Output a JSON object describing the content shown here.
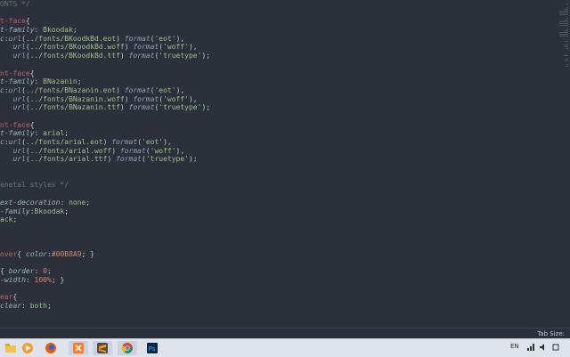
{
  "editor": {
    "lines": [
      [
        [
          "cmt",
          "ONTS */"
        ]
      ],
      [],
      [
        [
          "sel",
          "t-face"
        ],
        [
          "pl",
          "{"
        ]
      ],
      [
        [
          "prop",
          "t-family"
        ],
        [
          "pl",
          ": "
        ],
        [
          "val",
          "Bkoodak"
        ],
        [
          "pl",
          ";"
        ]
      ],
      [
        [
          "prop",
          "c"
        ],
        [
          "pl",
          ":"
        ],
        [
          "fn",
          "url"
        ],
        [
          "pl",
          "("
        ],
        [
          "val",
          "../fonts/BKoodkBd.eot"
        ],
        [
          "pl",
          ") "
        ],
        [
          "fn",
          "format"
        ],
        [
          "pl",
          "("
        ],
        [
          "val",
          "'eot'"
        ],
        [
          "pl",
          "),"
        ]
      ],
      [
        [
          "pl",
          "   "
        ],
        [
          "fn",
          "url"
        ],
        [
          "pl",
          "("
        ],
        [
          "val",
          "../fonts/BKoodkBd.woff"
        ],
        [
          "pl",
          ") "
        ],
        [
          "fn",
          "format"
        ],
        [
          "pl",
          "("
        ],
        [
          "val",
          "'woff'"
        ],
        [
          "pl",
          "),"
        ]
      ],
      [
        [
          "pl",
          "   "
        ],
        [
          "fn",
          "url"
        ],
        [
          "pl",
          "("
        ],
        [
          "val",
          "../fonts/BKoodkBd.ttf"
        ],
        [
          "pl",
          ") "
        ],
        [
          "fn",
          "format"
        ],
        [
          "pl",
          "("
        ],
        [
          "val",
          "'truetype'"
        ],
        [
          "pl",
          ");"
        ]
      ],
      [],
      [
        [
          "sel",
          "nt-face"
        ],
        [
          "pl",
          "{"
        ]
      ],
      [
        [
          "prop",
          "t-family"
        ],
        [
          "pl",
          ": "
        ],
        [
          "val",
          "BNazanin"
        ],
        [
          "pl",
          ";"
        ]
      ],
      [
        [
          "prop",
          "c"
        ],
        [
          "pl",
          ":"
        ],
        [
          "fn",
          "url"
        ],
        [
          "pl",
          "("
        ],
        [
          "val",
          "../fonts/BNazanin.eot"
        ],
        [
          "pl",
          ") "
        ],
        [
          "fn",
          "format"
        ],
        [
          "pl",
          "("
        ],
        [
          "val",
          "'eot'"
        ],
        [
          "pl",
          "),"
        ]
      ],
      [
        [
          "pl",
          "   "
        ],
        [
          "fn",
          "url"
        ],
        [
          "pl",
          "("
        ],
        [
          "val",
          "../fonts/BNazanin.woff"
        ],
        [
          "pl",
          ") "
        ],
        [
          "fn",
          "format"
        ],
        [
          "pl",
          "("
        ],
        [
          "val",
          "'woff'"
        ],
        [
          "pl",
          "),"
        ]
      ],
      [
        [
          "pl",
          "   "
        ],
        [
          "fn",
          "url"
        ],
        [
          "pl",
          "("
        ],
        [
          "val",
          "../fonts/BNazanin.ttf"
        ],
        [
          "pl",
          ") "
        ],
        [
          "fn",
          "format"
        ],
        [
          "pl",
          "("
        ],
        [
          "val",
          "'truetype'"
        ],
        [
          "pl",
          ");"
        ]
      ],
      [],
      [
        [
          "sel",
          "nt-face"
        ],
        [
          "pl",
          "{"
        ]
      ],
      [
        [
          "prop",
          "t-family"
        ],
        [
          "pl",
          ": "
        ],
        [
          "val",
          "arial"
        ],
        [
          "pl",
          ";"
        ]
      ],
      [
        [
          "prop",
          "c"
        ],
        [
          "pl",
          ":"
        ],
        [
          "fn",
          "url"
        ],
        [
          "pl",
          "("
        ],
        [
          "val",
          "../fonts/arial.eot"
        ],
        [
          "pl",
          ") "
        ],
        [
          "fn",
          "format"
        ],
        [
          "pl",
          "("
        ],
        [
          "val",
          "'eot'"
        ],
        [
          "pl",
          "),"
        ]
      ],
      [
        [
          "pl",
          "   "
        ],
        [
          "fn",
          "url"
        ],
        [
          "pl",
          "("
        ],
        [
          "val",
          "../fonts/arial.woff"
        ],
        [
          "pl",
          ") "
        ],
        [
          "fn",
          "format"
        ],
        [
          "pl",
          "("
        ],
        [
          "val",
          "'woff'"
        ],
        [
          "pl",
          "),"
        ]
      ],
      [
        [
          "pl",
          "   "
        ],
        [
          "fn",
          "url"
        ],
        [
          "pl",
          "("
        ],
        [
          "val",
          "../fonts/arial.ttf"
        ],
        [
          "pl",
          ") "
        ],
        [
          "fn",
          "format"
        ],
        [
          "pl",
          "("
        ],
        [
          "val",
          "'truetype'"
        ],
        [
          "pl",
          ");"
        ]
      ],
      [],
      [],
      [
        [
          "cmt",
          "enetal styles */"
        ]
      ],
      [],
      [
        [
          "prop",
          "ext-decoration"
        ],
        [
          "pl",
          ": "
        ],
        [
          "val",
          "none"
        ],
        [
          "pl",
          ";"
        ]
      ],
      [
        [
          "prop",
          "-family"
        ],
        [
          "pl",
          ":"
        ],
        [
          "val",
          "Bkoodak"
        ],
        [
          "pl",
          ";"
        ]
      ],
      [
        [
          "val",
          "ack"
        ],
        [
          "pl",
          ";"
        ]
      ],
      [],
      [],
      [],
      [
        [
          "sel",
          "over"
        ],
        [
          "pl",
          "{ "
        ],
        [
          "prop",
          "color"
        ],
        [
          "pl",
          ":"
        ],
        [
          "num",
          "#00B8A9"
        ],
        [
          "pl",
          "; }"
        ]
      ],
      [],
      [
        [
          "pl",
          "{ "
        ],
        [
          "prop",
          "border"
        ],
        [
          "pl",
          ": "
        ],
        [
          "num",
          "0"
        ],
        [
          "pl",
          ";"
        ]
      ],
      [
        [
          "prop",
          "-width"
        ],
        [
          "pl",
          ": "
        ],
        [
          "num",
          "100%"
        ],
        [
          "pl",
          "; }"
        ]
      ],
      [],
      [
        [
          "sel",
          "ear"
        ],
        [
          "pl",
          "{"
        ]
      ],
      [
        [
          "prop",
          "clear"
        ],
        [
          "pl",
          ": "
        ],
        [
          "val",
          "both"
        ],
        [
          "pl",
          ";"
        ]
      ]
    ]
  },
  "statusbar": {
    "tab_size": "Tab Size:"
  },
  "taskbar": {
    "apps": [
      {
        "name": "file-explorer-icon",
        "color": "#f2c14e"
      },
      {
        "name": "media-player-icon",
        "color": "#f59b2a"
      },
      {
        "name": "firefox-icon",
        "color": "#e66000"
      },
      {
        "name": "xampp-icon",
        "color": "#fb7a24"
      },
      {
        "name": "sublime-text-icon",
        "color": "#4b4b4b"
      },
      {
        "name": "chrome-icon",
        "color": "#4285f4"
      },
      {
        "name": "photoshop-icon",
        "color": "#0b2a4a"
      }
    ],
    "language": "EN"
  }
}
